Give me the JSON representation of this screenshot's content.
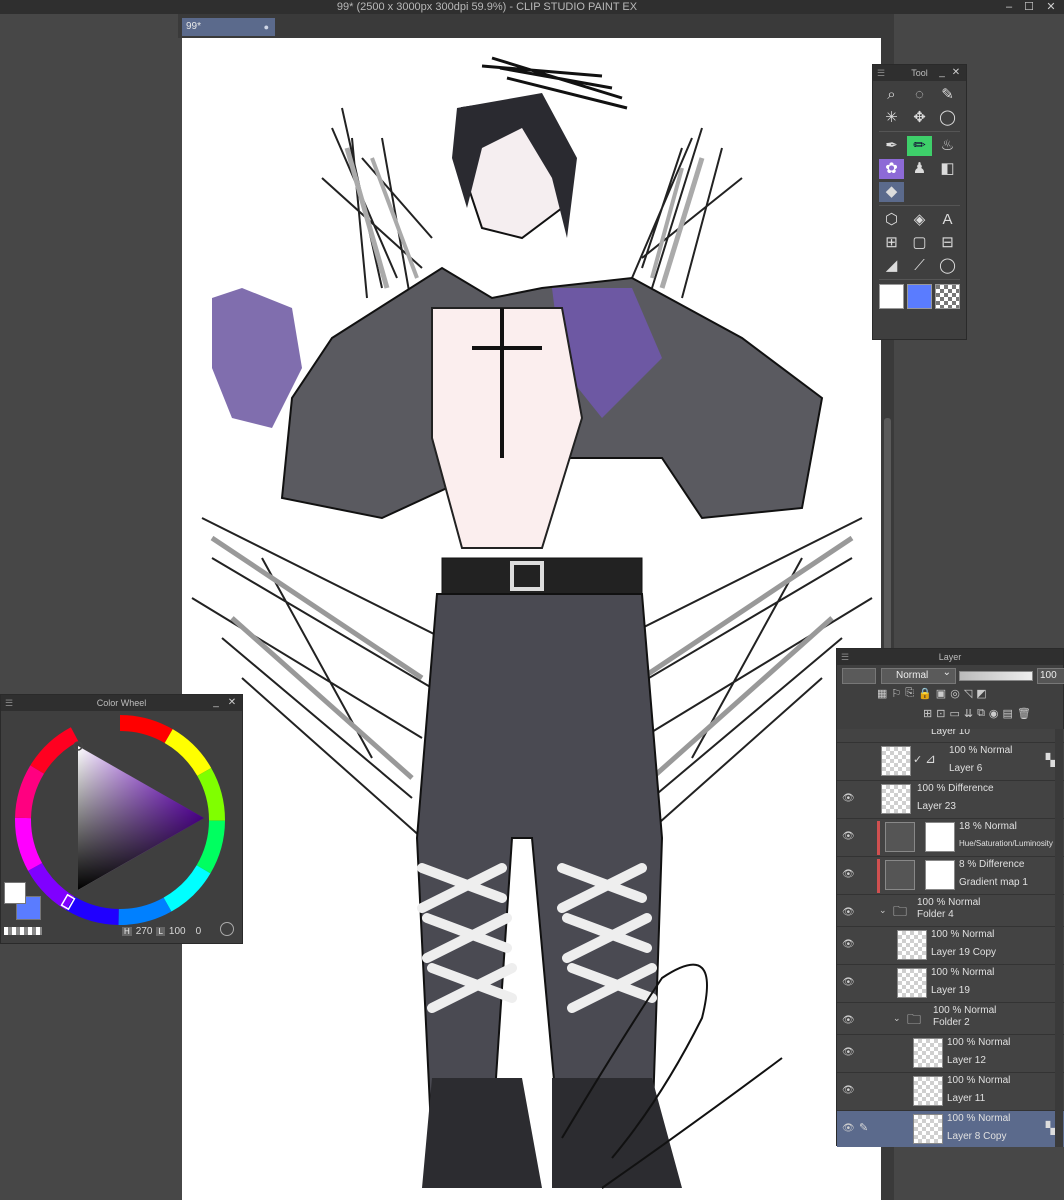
{
  "window": {
    "title": "99* (2500 x 3000px 300dpi 59.9%) - CLIP STUDIO PAINT EX",
    "controls": [
      "–",
      "☐",
      "✕"
    ]
  },
  "document_tab": {
    "label": "99*",
    "dot": "●"
  },
  "tool_panel": {
    "title": "Tool",
    "tools": [
      [
        "zoom-icon",
        "rotate-select-icon",
        "eyedropper-icon"
      ],
      [
        "auto-select-icon",
        "move-icon",
        "lasso-icon"
      ],
      [
        "pen-icon",
        "pencil-icon",
        "airbrush-icon"
      ],
      [
        "decoration-icon",
        "blend-icon",
        "gradient-icon"
      ],
      [
        "eraser-icon"
      ],
      [
        "figure-icon",
        "fill-icon",
        "text-icon"
      ],
      [
        "ruler-icon",
        "frame-icon",
        "operation-icon"
      ],
      [
        "correction-icon",
        "brush-pen-icon",
        "balloon-icon"
      ]
    ],
    "colors": {
      "main": "#ffffff",
      "sub": "#5a7cff"
    }
  },
  "color_wheel": {
    "title": "Color Wheel",
    "hue": "270",
    "saturation_value": "100",
    "value": "0",
    "main_color": "#ffffff",
    "sub_color": "#5a7cff"
  },
  "layer_panel": {
    "title": "Layer",
    "blend_mode": "Normal",
    "opacity": "100",
    "layers": [
      {
        "mode": "",
        "name": "Layer 10",
        "partial": true
      },
      {
        "mode": "100 % Normal",
        "name": "Layer 6",
        "visible": false
      },
      {
        "mode": "100 % Difference",
        "name": "Layer 23"
      },
      {
        "mode": "18 % Normal",
        "name": "Hue/Saturation/Luminosity",
        "correction": true
      },
      {
        "mode": "8 % Difference",
        "name": "Gradient map 1",
        "correction": true
      },
      {
        "mode": "100 % Normal",
        "name": "Folder 4",
        "folder": true
      },
      {
        "mode": "100 % Normal",
        "name": "Layer 19 Copy"
      },
      {
        "mode": "100 % Normal",
        "name": "Layer 19"
      },
      {
        "mode": "100 % Normal",
        "name": "Folder 2",
        "folder": true
      },
      {
        "mode": "100 % Normal",
        "name": "Layer 12"
      },
      {
        "mode": "100 % Normal",
        "name": "Layer 11"
      },
      {
        "mode": "100 % Normal",
        "name": "Layer 8 Copy",
        "selected": true
      }
    ]
  },
  "colors": {
    "accent": "#5b6a8c",
    "purple_paint": "#7a5aa8",
    "sub_color": "#5a7cff"
  }
}
